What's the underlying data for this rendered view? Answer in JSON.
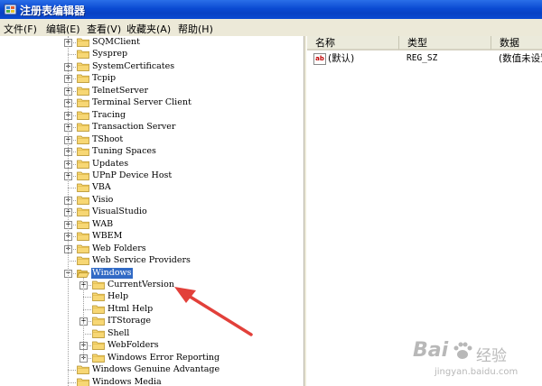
{
  "window": {
    "title": "注册表编辑器",
    "icon": "regedit-icon"
  },
  "menu": [
    {
      "label": "文件(F)"
    },
    {
      "label": "编辑(E)"
    },
    {
      "label": "查看(V)"
    },
    {
      "label": "收藏夹(A)"
    },
    {
      "label": "帮助(H)"
    }
  ],
  "tree": {
    "nodes": [
      {
        "label": "SQMClient",
        "level": 0,
        "expander": "plus"
      },
      {
        "label": "Sysprep",
        "level": 0,
        "expander": "none"
      },
      {
        "label": "SystemCertificates",
        "level": 0,
        "expander": "plus"
      },
      {
        "label": "Tcpip",
        "level": 0,
        "expander": "plus"
      },
      {
        "label": "TelnetServer",
        "level": 0,
        "expander": "plus"
      },
      {
        "label": "Terminal Server Client",
        "level": 0,
        "expander": "plus"
      },
      {
        "label": "Tracing",
        "level": 0,
        "expander": "plus"
      },
      {
        "label": "Transaction Server",
        "level": 0,
        "expander": "plus"
      },
      {
        "label": "TShoot",
        "level": 0,
        "expander": "plus"
      },
      {
        "label": "Tuning Spaces",
        "level": 0,
        "expander": "plus"
      },
      {
        "label": "Updates",
        "level": 0,
        "expander": "plus"
      },
      {
        "label": "UPnP Device Host",
        "level": 0,
        "expander": "plus"
      },
      {
        "label": "VBA",
        "level": 0,
        "expander": "none"
      },
      {
        "label": "Visio",
        "level": 0,
        "expander": "plus"
      },
      {
        "label": "VisualStudio",
        "level": 0,
        "expander": "plus"
      },
      {
        "label": "WAB",
        "level": 0,
        "expander": "plus"
      },
      {
        "label": "WBEM",
        "level": 0,
        "expander": "plus"
      },
      {
        "label": "Web Folders",
        "level": 0,
        "expander": "plus"
      },
      {
        "label": "Web Service Providers",
        "level": 0,
        "expander": "none"
      },
      {
        "label": "Windows",
        "level": 0,
        "expander": "minus",
        "selected": true,
        "open": true
      },
      {
        "label": "CurrentVersion",
        "level": 1,
        "expander": "plus"
      },
      {
        "label": "Help",
        "level": 1,
        "expander": "none"
      },
      {
        "label": "Html Help",
        "level": 1,
        "expander": "none"
      },
      {
        "label": "ITStorage",
        "level": 1,
        "expander": "plus"
      },
      {
        "label": "Shell",
        "level": 1,
        "expander": "none"
      },
      {
        "label": "WebFolders",
        "level": 1,
        "expander": "plus"
      },
      {
        "label": "Windows Error Reporting",
        "level": 1,
        "expander": "plus"
      },
      {
        "label": "Windows Genuine Advantage",
        "level": 0,
        "expander": "none"
      },
      {
        "label": "Windows Media",
        "level": 0,
        "expander": "none"
      }
    ]
  },
  "list": {
    "columns": [
      {
        "label": "名称"
      },
      {
        "label": "类型"
      },
      {
        "label": "数据"
      }
    ],
    "rows": [
      {
        "icon": "string-value-icon",
        "icon_text": "ab",
        "name": "(默认)",
        "type": "REG_SZ",
        "data": "(数值未设置)"
      }
    ]
  },
  "annotation": {
    "icon": "red-arrow-icon",
    "color": "#e2403a"
  },
  "watermark": {
    "brand": "Bai",
    "brand_suffix": "经验",
    "url": "jingyan.baidu.com",
    "icon": "baidu-paw-icon"
  },
  "colors": {
    "titlebar": "#0a4ad2",
    "selection": "#316ac5",
    "folder": "#f7d774"
  }
}
